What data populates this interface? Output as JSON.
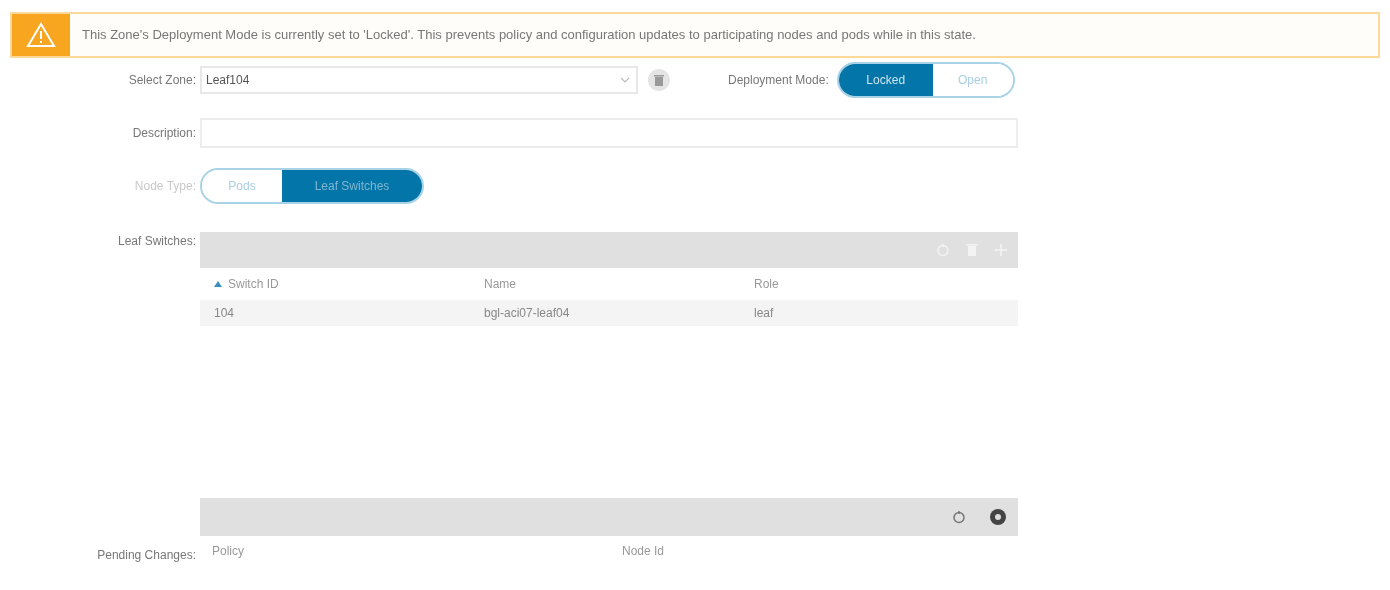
{
  "banner": {
    "text": "This Zone's Deployment Mode is currently set to 'Locked'. This prevents policy and configuration updates to participating nodes and pods while in this state."
  },
  "zone": {
    "label": "Select Zone:",
    "value": "Leaf104"
  },
  "deployment_mode": {
    "label": "Deployment Mode:",
    "options": [
      {
        "label": "Locked",
        "selected": true
      },
      {
        "label": "Open",
        "selected": false
      }
    ]
  },
  "description": {
    "label": "Description:"
  },
  "node_type": {
    "label": "Node Type:",
    "disabled": true,
    "options": [
      {
        "label": "Pods",
        "selected": false
      },
      {
        "label": "Leaf Switches",
        "selected": true
      }
    ]
  },
  "leaf_switches": {
    "label": "Leaf Switches:",
    "columns": [
      {
        "label": "Switch ID",
        "sorted": true
      },
      {
        "label": "Name",
        "sorted": false
      },
      {
        "label": "Role",
        "sorted": false
      }
    ],
    "rows": [
      [
        "104",
        "bgl-aci07-leaf04",
        "leaf"
      ]
    ]
  },
  "pending_changes": {
    "label": "Pending Changes:",
    "columns": [
      "Policy",
      "Node Id"
    ]
  }
}
